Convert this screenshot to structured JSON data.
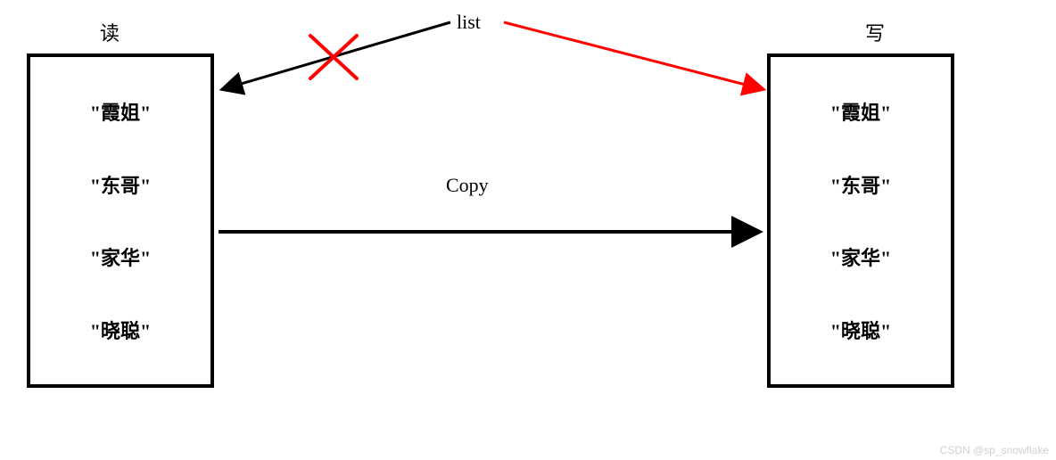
{
  "labels": {
    "read": "读",
    "write": "写",
    "list": "list",
    "copy": "Copy"
  },
  "left_box": {
    "items": [
      "\"霞姐\"",
      "\"东哥\"",
      "\"家华\"",
      "\"晓聪\""
    ]
  },
  "right_box": {
    "items": [
      "\"霞姐\"",
      "\"东哥\"",
      "\"家华\"",
      "\"晓聪\""
    ]
  },
  "arrows": {
    "list_to_left": {
      "blocked": true,
      "color": "#000000",
      "x_mark_color": "#ff0000"
    },
    "list_to_right": {
      "blocked": false,
      "color": "#ff0000"
    },
    "copy_left_to_right": {
      "color": "#000000"
    }
  },
  "watermark": "CSDN @sp_snowflake"
}
